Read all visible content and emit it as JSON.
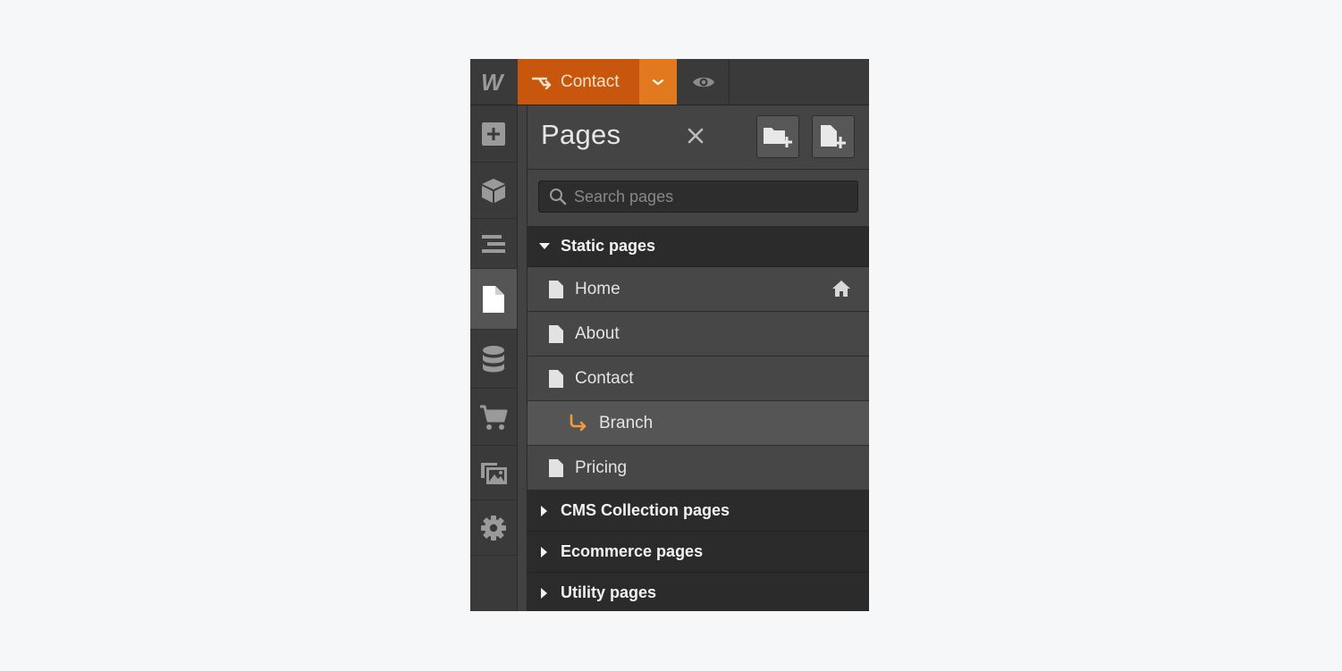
{
  "topbar": {
    "logo": "W",
    "current_page": "Contact",
    "branch_icon": "branch-icon",
    "dropdown_icon": "chevron-down-icon",
    "preview_icon": "eye-icon"
  },
  "leftnav": {
    "items": [
      {
        "name": "add-elements",
        "icon": "plus-square-icon"
      },
      {
        "name": "symbols",
        "icon": "cube-icon"
      },
      {
        "name": "navigator",
        "icon": "navigator-icon"
      },
      {
        "name": "pages",
        "icon": "page-icon",
        "active": true
      },
      {
        "name": "cms",
        "icon": "database-icon"
      },
      {
        "name": "ecommerce",
        "icon": "cart-icon"
      },
      {
        "name": "assets",
        "icon": "images-icon"
      },
      {
        "name": "settings",
        "icon": "gear-icon"
      }
    ]
  },
  "panel": {
    "title": "Pages",
    "close_icon": "close-icon",
    "new_folder_icon": "folder-add-icon",
    "new_page_icon": "page-add-icon",
    "search_placeholder": "Search pages"
  },
  "sections": {
    "static": {
      "label": "Static pages",
      "expanded": true
    },
    "cms": {
      "label": "CMS Collection pages",
      "expanded": false
    },
    "ecommerce": {
      "label": "Ecommerce pages",
      "expanded": false
    },
    "utility": {
      "label": "Utility pages",
      "expanded": false
    }
  },
  "pages": {
    "home": {
      "label": "Home",
      "is_home": true
    },
    "about": {
      "label": "About"
    },
    "contact": {
      "label": "Contact"
    },
    "branch": {
      "label": "Branch"
    },
    "pricing": {
      "label": "Pricing"
    }
  },
  "colors": {
    "accent": "#c8560d",
    "accent_light": "#e2791f",
    "branch": "#f59a3b",
    "panel_bg": "#444444",
    "section_bg": "#2b2b2b"
  }
}
